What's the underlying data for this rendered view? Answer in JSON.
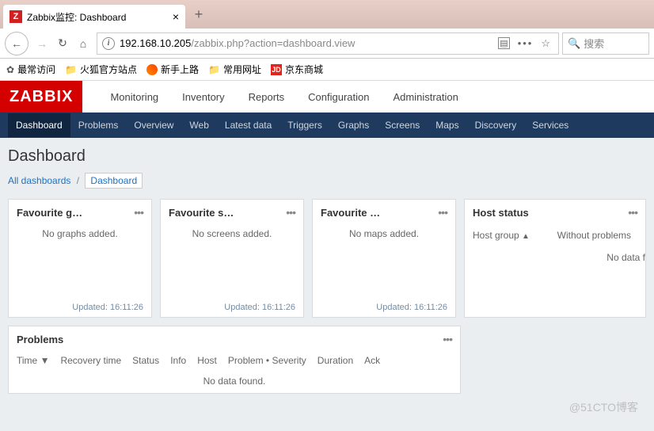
{
  "browser": {
    "tab_title": "Zabbix监控: Dashboard",
    "url_host": "192.168.10.205",
    "url_path": "/zabbix.php?action=dashboard.view",
    "search_placeholder": "搜索"
  },
  "bookmarks": {
    "most_visited": "最常访问",
    "firefox_official": "火狐官方站点",
    "getting_started": "新手上路",
    "common_urls": "常用网址",
    "jd_mall": "京东商城"
  },
  "logo": "ZABBIX",
  "main_nav": {
    "monitoring": "Monitoring",
    "inventory": "Inventory",
    "reports": "Reports",
    "configuration": "Configuration",
    "administration": "Administration"
  },
  "sub_nav": {
    "dashboard": "Dashboard",
    "problems": "Problems",
    "overview": "Overview",
    "web": "Web",
    "latest_data": "Latest data",
    "triggers": "Triggers",
    "graphs": "Graphs",
    "screens": "Screens",
    "maps": "Maps",
    "discovery": "Discovery",
    "services": "Services"
  },
  "page_title": "Dashboard",
  "breadcrumb": {
    "all": "All dashboards",
    "current": "Dashboard"
  },
  "widgets": {
    "fav_graphs": {
      "title": "Favourite g…",
      "body": "No graphs added.",
      "footer": "Updated: 16:11:26"
    },
    "fav_screens": {
      "title": "Favourite s…",
      "body": "No screens added.",
      "footer": "Updated: 16:11:26"
    },
    "fav_maps": {
      "title": "Favourite …",
      "body": "No maps added.",
      "footer": "Updated: 16:11:26"
    },
    "host_status": {
      "title": "Host status",
      "col_hostgroup": "Host group",
      "sort": "▲",
      "col_without": "Without problems",
      "no_data": "No data f"
    },
    "problems": {
      "title": "Problems",
      "cols": {
        "time": "Time",
        "sort": "▼",
        "recovery": "Recovery time",
        "status": "Status",
        "info": "Info",
        "host": "Host",
        "problem": "Problem • Severity",
        "duration": "Duration",
        "ack": "Ack"
      },
      "no_data": "No data found."
    }
  },
  "watermark": "@51CTO博客"
}
